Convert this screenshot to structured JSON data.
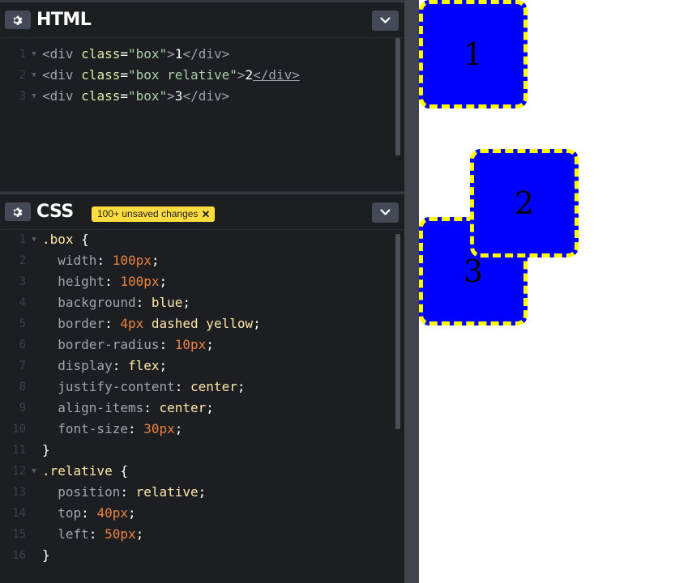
{
  "html_panel": {
    "title": "HTML",
    "settings_icon": "gear-icon",
    "collapse_icon": "chevron-down-icon",
    "lines": [
      {
        "n": "1",
        "tokens": [
          [
            "tag",
            "<div "
          ],
          [
            "attr",
            "class"
          ],
          [
            "punc",
            "="
          ],
          [
            "str",
            "\"box\""
          ],
          [
            "tag",
            ">"
          ],
          [
            "txt",
            "1"
          ],
          [
            "tag",
            "</div>"
          ]
        ]
      },
      {
        "n": "2",
        "tokens": [
          [
            "tag",
            "<div "
          ],
          [
            "attr",
            "class"
          ],
          [
            "punc",
            "="
          ],
          [
            "str",
            "\"box relative\""
          ],
          [
            "tag",
            ">"
          ],
          [
            "txt",
            "2"
          ],
          [
            "tagu",
            "</div>"
          ]
        ]
      },
      {
        "n": "3",
        "tokens": [
          [
            "tag",
            "<div "
          ],
          [
            "attr",
            "class"
          ],
          [
            "punc",
            "="
          ],
          [
            "str",
            "\"box\""
          ],
          [
            "tag",
            ">"
          ],
          [
            "txt",
            "3"
          ],
          [
            "tag",
            "</div>"
          ]
        ]
      }
    ]
  },
  "css_panel": {
    "title": "CSS",
    "unsaved_badge": "100+ unsaved changes",
    "unsaved_close": "✕",
    "settings_icon": "gear-icon",
    "collapse_icon": "chevron-down-icon",
    "lines": [
      {
        "n": "1",
        "fold": true,
        "tokens": [
          [
            "sel",
            ".box"
          ],
          [
            "punc",
            " {"
          ]
        ]
      },
      {
        "n": "2",
        "tokens": [
          [
            "punc",
            "  "
          ],
          [
            "prop",
            "width"
          ],
          [
            "punc",
            ": "
          ],
          [
            "num",
            "100px"
          ],
          [
            "punc",
            ";"
          ]
        ]
      },
      {
        "n": "3",
        "tokens": [
          [
            "punc",
            "  "
          ],
          [
            "prop",
            "height"
          ],
          [
            "punc",
            ": "
          ],
          [
            "num",
            "100px"
          ],
          [
            "punc",
            ";"
          ]
        ]
      },
      {
        "n": "4",
        "tokens": [
          [
            "punc",
            "  "
          ],
          [
            "prop",
            "background"
          ],
          [
            "punc",
            ": "
          ],
          [
            "kw",
            "blue"
          ],
          [
            "punc",
            ";"
          ]
        ]
      },
      {
        "n": "5",
        "tokens": [
          [
            "punc",
            "  "
          ],
          [
            "prop",
            "border"
          ],
          [
            "punc",
            ": "
          ],
          [
            "num",
            "4px"
          ],
          [
            "punc",
            " "
          ],
          [
            "kw",
            "dashed yellow"
          ],
          [
            "punc",
            ";"
          ]
        ]
      },
      {
        "n": "6",
        "tokens": [
          [
            "punc",
            "  "
          ],
          [
            "prop",
            "border-radius"
          ],
          [
            "punc",
            ": "
          ],
          [
            "num",
            "10px"
          ],
          [
            "punc",
            ";"
          ]
        ]
      },
      {
        "n": "7",
        "tokens": [
          [
            "punc",
            "  "
          ],
          [
            "prop",
            "display"
          ],
          [
            "punc",
            ": "
          ],
          [
            "kw",
            "flex"
          ],
          [
            "punc",
            ";"
          ]
        ]
      },
      {
        "n": "8",
        "tokens": [
          [
            "punc",
            "  "
          ],
          [
            "prop",
            "justify-content"
          ],
          [
            "punc",
            ": "
          ],
          [
            "kw",
            "center"
          ],
          [
            "punc",
            ";"
          ]
        ]
      },
      {
        "n": "9",
        "tokens": [
          [
            "punc",
            "  "
          ],
          [
            "prop",
            "align-items"
          ],
          [
            "punc",
            ": "
          ],
          [
            "kw",
            "center"
          ],
          [
            "punc",
            ";"
          ]
        ]
      },
      {
        "n": "10",
        "tokens": [
          [
            "punc",
            "  "
          ],
          [
            "prop",
            "font-size"
          ],
          [
            "punc",
            ": "
          ],
          [
            "num",
            "30px"
          ],
          [
            "punc",
            ";"
          ]
        ]
      },
      {
        "n": "11",
        "tokens": [
          [
            "punc",
            "}"
          ]
        ]
      },
      {
        "n": "12",
        "fold": true,
        "tokens": [
          [
            "sel",
            ".relative"
          ],
          [
            "punc",
            " {"
          ]
        ]
      },
      {
        "n": "13",
        "tokens": [
          [
            "punc",
            "  "
          ],
          [
            "prop",
            "position"
          ],
          [
            "punc",
            ": "
          ],
          [
            "kw",
            "relative"
          ],
          [
            "punc",
            ";"
          ]
        ]
      },
      {
        "n": "14",
        "tokens": [
          [
            "punc",
            "  "
          ],
          [
            "prop",
            "top"
          ],
          [
            "punc",
            ": "
          ],
          [
            "num",
            "40px"
          ],
          [
            "punc",
            ";"
          ]
        ]
      },
      {
        "n": "15",
        "tokens": [
          [
            "punc",
            "  "
          ],
          [
            "prop",
            "left"
          ],
          [
            "punc",
            ": "
          ],
          [
            "num",
            "50px"
          ],
          [
            "punc",
            ";"
          ]
        ]
      },
      {
        "n": "16",
        "tokens": [
          [
            "punc",
            "}"
          ]
        ]
      }
    ]
  },
  "preview": {
    "boxes": [
      {
        "label": "1",
        "class": "box"
      },
      {
        "label": "2",
        "class": "box relative"
      },
      {
        "label": "3",
        "class": "box"
      }
    ]
  },
  "colors": {
    "editor_bg": "#1d1e22",
    "button_bg": "#444857",
    "badge_bg": "#ffdd40",
    "box_bg": "#0000ff",
    "box_border": "#ffff00"
  }
}
